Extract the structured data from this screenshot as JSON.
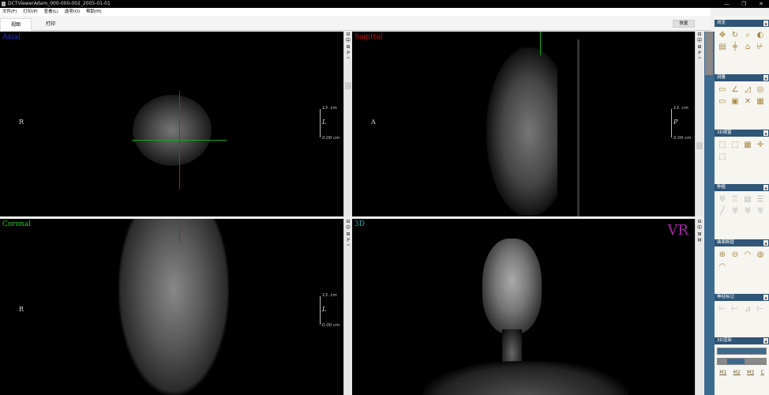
{
  "window": {
    "title": "DCTViewerAdam_000-000-002_2005-01-01",
    "controls": [
      "—",
      "❐",
      "✕"
    ]
  },
  "menu": [
    "文件(F)",
    "打印(P)",
    "查看(L)",
    "选项(O)",
    "帮助(H)"
  ],
  "tabs": [
    {
      "label": "视图",
      "active": true
    },
    {
      "label": "打印",
      "active": false
    }
  ],
  "restore_label": "恢复",
  "views": {
    "axial": {
      "label": "Axial",
      "color": "#2233cc",
      "left": "R",
      "right": "L",
      "ruler_top": "13.  cm",
      "ruler_bottom": "0.00  cm"
    },
    "sagittal": {
      "label": "Sagittal",
      "color": "#cc1111",
      "left": "A",
      "right": "P",
      "ruler_top": "13.  cm",
      "ruler_bottom": "0.00  cm"
    },
    "coronal": {
      "label": "Coronal",
      "color": "#22cc22",
      "left": "R",
      "right": "L",
      "ruler_top": "13.  cm",
      "ruler_bottom": "0.00  cm"
    },
    "3d": {
      "label": "3D",
      "color": "#22aaaa",
      "mode": "VR",
      "mode_color": "#aa22aa"
    }
  },
  "view_toolbar": [
    "⊟",
    "中",
    "⊞",
    "P",
    "^"
  ],
  "view_toolbar_3d": [
    "⊟",
    "中",
    "⊞",
    "M"
  ],
  "panel": {
    "sections": [
      {
        "title": "浏览",
        "icons": [
          "move-icon",
          "rotate-icon",
          "zoom-icon",
          "contrast-icon",
          "report-icon",
          "align-icon",
          "home-icon",
          "axis-icon"
        ]
      },
      {
        "title": "测量",
        "icons": [
          "ruler-icon",
          "angle-icon",
          "area-icon",
          "density-icon",
          "length-icon",
          "3d-measure-icon",
          "cross-measure-icon",
          "label-icon"
        ]
      },
      {
        "title": "3D视窗",
        "icons": [
          "cube-icon",
          "cube-center-icon",
          "cube-grid-icon",
          "crosshair-icon",
          "cube-small-icon"
        ]
      },
      {
        "title": "种植",
        "icons": [
          "tooth-icon",
          "implant-icon",
          "library-icon",
          "nerve-icon",
          "line-icon",
          "tooth-add-icon",
          "tooth-edit-icon",
          "tooth-remove-icon"
        ]
      },
      {
        "title": "曲面断层",
        "icons": [
          "arch-add-icon",
          "arch-remove-icon",
          "arch-icon",
          "arch-edit-icon",
          "arch-view-icon"
        ]
      },
      {
        "title": "神经标记",
        "icons": [
          "nerve-add-icon",
          "nerve-remove-icon",
          "nerve-edit-icon",
          "nerve-view-icon"
        ]
      },
      {
        "title": "3D渲染",
        "buttons": [
          "M1",
          "M2",
          "M3",
          "C"
        ]
      }
    ]
  }
}
